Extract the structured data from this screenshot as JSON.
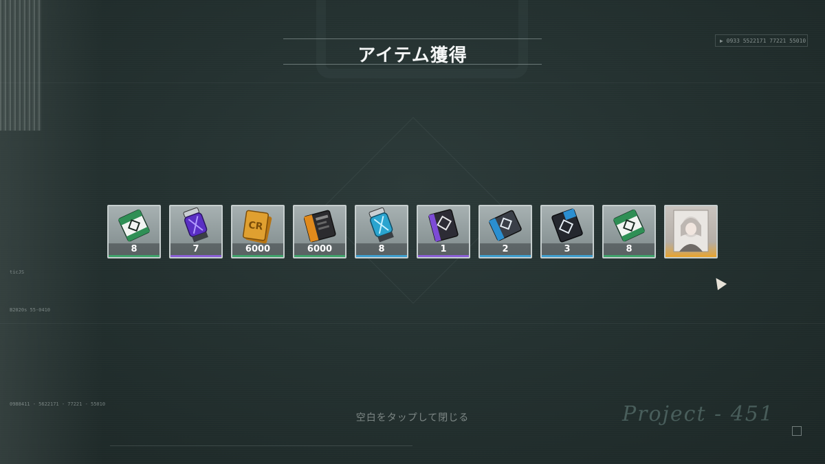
{
  "screen": {
    "title": "アイテム獲得",
    "hint": "空白をタップして閉じる",
    "hud_code": "▶ 0933  5522171  77221  55010 T",
    "logo_text": "Project - 451"
  },
  "left_hud": {
    "line1": "ticJS",
    "line2": "B2020s  55-0410",
    "line3": "0988411 - 5622171 - 77221 - 55010"
  },
  "items": [
    {
      "count": "8",
      "icon": "green-white-ticket-icon",
      "rarity_color": "#3fa36b"
    },
    {
      "count": "7",
      "icon": "purple-canister-icon",
      "rarity_color": "#8a5fd6"
    },
    {
      "count": "6000",
      "icon": "gold-credit-card-icon",
      "rarity_color": "#3fa36b"
    },
    {
      "count": "6000",
      "icon": "dark-credit-card-icon",
      "rarity_color": "#3fa36b"
    },
    {
      "count": "8",
      "icon": "blue-canister-icon",
      "rarity_color": "#3e9fcf"
    },
    {
      "count": "1",
      "icon": "purple-keycard-icon",
      "rarity_color": "#8a5fd6"
    },
    {
      "count": "2",
      "icon": "blue-chip-module-icon",
      "rarity_color": "#3e9fcf"
    },
    {
      "count": "3",
      "icon": "blue-dark-keycard-icon",
      "rarity_color": "#3e9fcf"
    },
    {
      "count": "8",
      "icon": "green-white-ticket-icon",
      "rarity_color": "#3fa36b"
    },
    {
      "count": "",
      "icon": "character-card-icon",
      "rarity_color": "#e3a436"
    }
  ]
}
